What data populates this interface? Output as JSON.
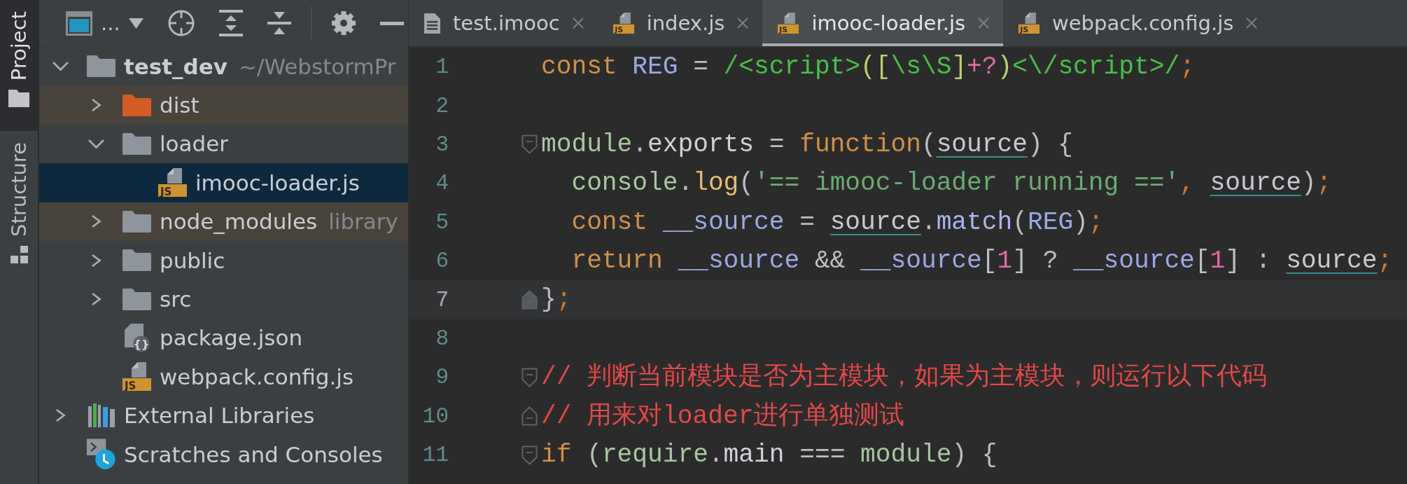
{
  "tool_strip": {
    "tabs": [
      {
        "label": "Project",
        "kind": "project",
        "selected": true
      },
      {
        "label": "Structure",
        "kind": "structure",
        "selected": false
      }
    ]
  },
  "project_panel": {
    "view_selector": {
      "label": "..."
    },
    "tree": [
      {
        "label": "test_dev",
        "hint": "~/WebstormPr",
        "kind": "root-folder",
        "expanded": true,
        "selected": false,
        "children": [
          {
            "label": "dist",
            "kind": "excluded-folder",
            "expanded": false,
            "selected": false,
            "color": "#48433b"
          },
          {
            "label": "loader",
            "kind": "folder",
            "expanded": true,
            "selected": false,
            "children": [
              {
                "label": "imooc-loader.js",
                "kind": "js-file",
                "badge": "JS",
                "selected": true
              }
            ]
          },
          {
            "label": "node_modules",
            "hint": "library",
            "kind": "folder",
            "expanded": false,
            "selected": false,
            "color": "#48433b"
          },
          {
            "label": "public",
            "kind": "folder",
            "expanded": false,
            "selected": false
          },
          {
            "label": "src",
            "kind": "folder",
            "expanded": false,
            "selected": false
          },
          {
            "label": "package.json",
            "kind": "json-file",
            "badge": "{}",
            "selected": false
          },
          {
            "label": "webpack.config.js",
            "kind": "js-file",
            "badge": "JS",
            "selected": false
          }
        ]
      },
      {
        "label": "External Libraries",
        "kind": "libraries",
        "expanded": false,
        "selected": false
      },
      {
        "label": "Scratches and Consoles",
        "kind": "scratches",
        "selected": false
      }
    ]
  },
  "editor": {
    "tabs": [
      {
        "label": "test.imooc",
        "kind": "text-file",
        "selected": false
      },
      {
        "label": "index.js",
        "kind": "js-file",
        "badge": "JS",
        "selected": false
      },
      {
        "label": "imooc-loader.js",
        "kind": "js-file",
        "badge": "JS",
        "selected": true
      },
      {
        "label": "webpack.config.js",
        "kind": "js-file",
        "badge": "JS",
        "selected": false
      }
    ],
    "lines": [
      {
        "number": "1",
        "current": false,
        "tokens": [
          {
            "text": "const ",
            "kind": "keyword"
          },
          {
            "text": "REG",
            "kind": "variable"
          },
          {
            "text": " = ",
            "kind": "plain"
          },
          {
            "text": "/<script>",
            "kind": "regex"
          },
          {
            "text": "([",
            "kind": "regex-group"
          },
          {
            "text": "\\s\\S",
            "kind": "regex"
          },
          {
            "text": "]",
            "kind": "regex-group"
          },
          {
            "text": "+?",
            "kind": "regex-quant"
          },
          {
            "text": ")",
            "kind": "regex-group"
          },
          {
            "text": "<\\/script>/",
            "kind": "regex"
          },
          {
            "text": ";",
            "kind": "punct"
          }
        ]
      },
      {
        "number": "2",
        "current": false
      },
      {
        "number": "3",
        "current": false,
        "fold": {
          "kind": "start"
        },
        "tokens": [
          {
            "text": "module",
            "kind": "global"
          },
          {
            "text": ".",
            "kind": "plain"
          },
          {
            "text": "exports",
            "kind": "property"
          },
          {
            "text": " = ",
            "kind": "plain"
          },
          {
            "text": "function",
            "kind": "keyword"
          },
          {
            "text": "(",
            "kind": "plain"
          },
          {
            "text": "source",
            "kind": "param"
          },
          {
            "text": ") {",
            "kind": "plain"
          }
        ]
      },
      {
        "number": "4",
        "current": false,
        "tokens": [
          {
            "text": "  console",
            "kind": "global"
          },
          {
            "text": ".",
            "kind": "plain"
          },
          {
            "text": "log",
            "kind": "method"
          },
          {
            "text": "(",
            "kind": "plain"
          },
          {
            "text": "'== imooc-loader running =='",
            "kind": "string"
          },
          {
            "text": ", ",
            "kind": "punct"
          },
          {
            "text": "source",
            "kind": "param"
          },
          {
            "text": ")",
            "kind": "plain"
          },
          {
            "text": ";",
            "kind": "punct"
          }
        ]
      },
      {
        "number": "5",
        "current": false,
        "tokens": [
          {
            "text": "  const ",
            "kind": "keyword"
          },
          {
            "text": "__source",
            "kind": "variable"
          },
          {
            "text": " = ",
            "kind": "plain"
          },
          {
            "text": "source",
            "kind": "param"
          },
          {
            "text": ".",
            "kind": "plain"
          },
          {
            "text": "match",
            "kind": "member"
          },
          {
            "text": "(",
            "kind": "plain"
          },
          {
            "text": "REG",
            "kind": "variable"
          },
          {
            "text": ")",
            "kind": "plain"
          },
          {
            "text": ";",
            "kind": "punct"
          }
        ]
      },
      {
        "number": "6",
        "current": false,
        "tokens": [
          {
            "text": "  return ",
            "kind": "keyword"
          },
          {
            "text": "__source",
            "kind": "variable"
          },
          {
            "text": " && ",
            "kind": "plain"
          },
          {
            "text": "__source",
            "kind": "variable"
          },
          {
            "text": "[",
            "kind": "plain"
          },
          {
            "text": "1",
            "kind": "number"
          },
          {
            "text": "] ? ",
            "kind": "plain"
          },
          {
            "text": "__source",
            "kind": "variable"
          },
          {
            "text": "[",
            "kind": "plain"
          },
          {
            "text": "1",
            "kind": "number"
          },
          {
            "text": "] : ",
            "kind": "plain"
          },
          {
            "text": "source",
            "kind": "param"
          },
          {
            "text": ";",
            "kind": "punct"
          }
        ]
      },
      {
        "number": "7",
        "current": true,
        "fold": {
          "kind": "end"
        },
        "tokens": [
          {
            "text": "}",
            "kind": "plain"
          },
          {
            "text": ";",
            "kind": "punct"
          }
        ]
      },
      {
        "number": "8",
        "current": false
      },
      {
        "number": "9",
        "current": false,
        "fold": {
          "kind": "start"
        },
        "tokens": [
          {
            "text": "// 判断当前模块是否为主模块，如果为主模块，则运行以下代码",
            "kind": "comment"
          }
        ]
      },
      {
        "number": "10",
        "current": false,
        "fold": {
          "kind": "end"
        },
        "tokens": [
          {
            "text": "// 用来对loader进行单独测试",
            "kind": "comment"
          }
        ]
      },
      {
        "number": "11",
        "current": false,
        "fold": {
          "kind": "start"
        },
        "tokens": [
          {
            "text": "if",
            "kind": "keyword"
          },
          {
            "text": " (",
            "kind": "plain"
          },
          {
            "text": "require",
            "kind": "global"
          },
          {
            "text": ".",
            "kind": "plain"
          },
          {
            "text": "main",
            "kind": "property"
          },
          {
            "text": " === ",
            "kind": "plain"
          },
          {
            "text": "module",
            "kind": "global"
          },
          {
            "text": ") {",
            "kind": "plain"
          }
        ]
      }
    ]
  }
}
